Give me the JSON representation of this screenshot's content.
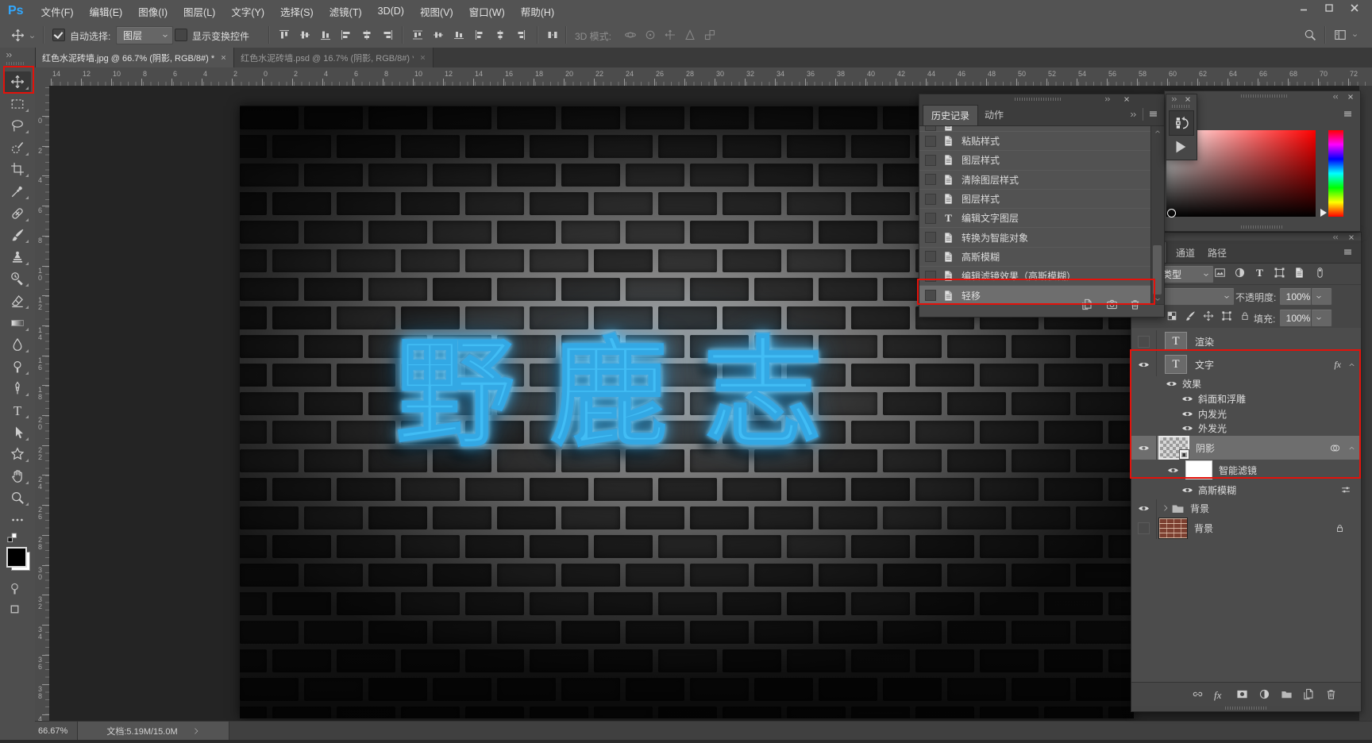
{
  "menubar": {
    "logo": "Ps",
    "items": [
      "文件(F)",
      "编辑(E)",
      "图像(I)",
      "图层(L)",
      "文字(Y)",
      "选择(S)",
      "滤镜(T)",
      "3D(D)",
      "视图(V)",
      "窗口(W)",
      "帮助(H)"
    ]
  },
  "window_controls": [
    "minimize",
    "maximize",
    "close"
  ],
  "options": {
    "auto_select_label": "自动选择:",
    "auto_select_checked": true,
    "auto_select_target": "图层",
    "show_transform_label": "显示变换控件",
    "show_transform_checked": false,
    "mode3d_label": "3D 模式:"
  },
  "doc_tabs": [
    {
      "title": "红色水泥砖墙.jpg @ 66.7% (阴影, RGB/8#) *",
      "active": true
    },
    {
      "title": "红色水泥砖墙.psd @ 16.7% (阴影, RGB/8#) *",
      "active": false
    }
  ],
  "toolbar": {
    "tools": [
      "move",
      "rectangular-marquee",
      "lasso",
      "quick-selection",
      "crop",
      "eyedropper",
      "spot-healing",
      "brush",
      "clone-stamp",
      "history-brush",
      "eraser",
      "gradient",
      "blur",
      "dodge",
      "pen",
      "type",
      "path-selection",
      "custom-shape",
      "hand",
      "zoom",
      "edit-toolbar"
    ],
    "active_tool": "move",
    "foreground_color": "#000000",
    "background_color": "#ffffff"
  },
  "ruler_h": [
    "14",
    "12",
    "10",
    "8",
    "6",
    "4",
    "2",
    "0",
    "2",
    "4",
    "6",
    "8",
    "10",
    "12",
    "14",
    "16",
    "18",
    "20",
    "22",
    "24",
    "26",
    "28",
    "30",
    "32",
    "34",
    "36",
    "38",
    "40",
    "42",
    "44",
    "46",
    "48",
    "50",
    "52",
    "54",
    "56",
    "58",
    "60",
    "62",
    "64",
    "66",
    "68",
    "70",
    "72"
  ],
  "ruler_v": [
    "0",
    "2",
    "4",
    "6",
    "8",
    "10",
    "12",
    "14",
    "16",
    "18",
    "20",
    "22",
    "24",
    "26",
    "28",
    "30",
    "32",
    "34",
    "36",
    "38",
    "40"
  ],
  "canvas": {
    "text": "野鹿志",
    "text_color": "#41bdf5"
  },
  "history": {
    "tabs": [
      "历史记录",
      "动作"
    ],
    "active_tab": "历史记录",
    "items": [
      {
        "label": "粘贴样式",
        "icon": "doc",
        "selected": false
      },
      {
        "label": "图层样式",
        "icon": "doc",
        "selected": false
      },
      {
        "label": "清除图层样式",
        "icon": "doc",
        "selected": false
      },
      {
        "label": "图层样式",
        "icon": "doc",
        "selected": false
      },
      {
        "label": "编辑文字图层",
        "icon": "T",
        "selected": false
      },
      {
        "label": "转换为智能对象",
        "icon": "doc",
        "selected": false
      },
      {
        "label": "高斯模糊",
        "icon": "doc",
        "selected": false
      },
      {
        "label": "编辑滤镜效果（高斯模糊）",
        "icon": "doc",
        "selected": false
      },
      {
        "label": "轻移",
        "icon": "doc",
        "selected": true
      }
    ]
  },
  "color_panel": {
    "field_hue": "#ff0000",
    "hue_ramp": [
      "#ff0000",
      "#ff00ff",
      "#0000ff",
      "#00ffff",
      "#00ff00",
      "#ffff00",
      "#ff0000"
    ]
  },
  "layers": {
    "tabs": [
      "通道",
      "路径"
    ],
    "filter_label": "类型",
    "opacity_label": "不透明度:",
    "opacity_value": "100%",
    "fill_label": "填充:",
    "fill_value": "100%",
    "rows": [
      {
        "kind": "text-layer",
        "label": "渲染",
        "visible": false,
        "thumb": "T"
      },
      {
        "kind": "text-layer",
        "label": "文字",
        "visible": true,
        "thumb": "T",
        "fx": "fx",
        "collapse": true
      },
      {
        "kind": "fx-head",
        "label": "效果",
        "visible": true
      },
      {
        "kind": "fx",
        "label": "斜面和浮雕",
        "visible": true
      },
      {
        "kind": "fx",
        "label": "内发光",
        "visible": true
      },
      {
        "kind": "fx",
        "label": "外发光",
        "visible": true
      },
      {
        "kind": "smart-layer",
        "label": "阴影",
        "visible": true,
        "thumb": "checker",
        "selected": true,
        "collapse": true
      },
      {
        "kind": "smart-filters",
        "label": "智能滤镜",
        "visible": true,
        "thumb": "white"
      },
      {
        "kind": "fx",
        "label": "高斯模糊",
        "visible": true,
        "slider": true
      },
      {
        "kind": "group",
        "label": "背景",
        "visible": true
      },
      {
        "kind": "background",
        "label": "背景",
        "visible": false,
        "thumb": "brick",
        "locked": true
      }
    ]
  },
  "status": {
    "zoom": "66.67%",
    "doc_info": "文档:5.19M/15.0M"
  },
  "annotation_color": "#e3120b"
}
